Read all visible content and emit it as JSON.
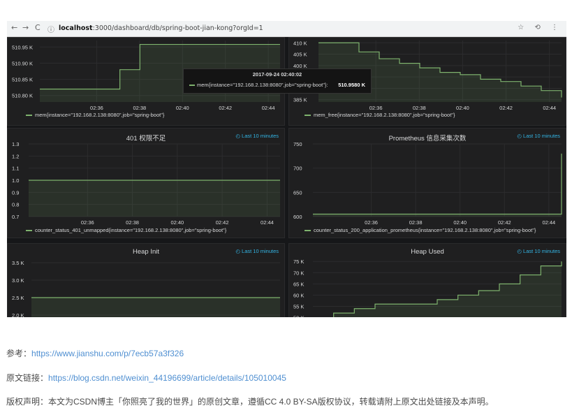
{
  "browser": {
    "url_host": "localhost",
    "url_rest": ":3000/dashboard/db/spring-boot-jian-kong?orgId=1",
    "back": "←",
    "forward": "→",
    "reload": "C",
    "info": "ⓘ"
  },
  "colors": {
    "series": "#7eb26d",
    "time_link": "#33b5e5",
    "panel_bg": "#1f1f20",
    "page_bg": "#161719"
  },
  "panels": [
    {
      "id": "mem",
      "title": "",
      "time_label": "",
      "legend": "mem{instance=\"192.168.2.138:8080\",job=\"spring-boot\"}"
    },
    {
      "id": "mem_free",
      "title": "",
      "time_label": "",
      "legend": "mem_free{instance=\"192.168.2.138:8080\",job=\"spring-boot\"}"
    },
    {
      "id": "c401",
      "title": "401 权限不足",
      "time_label": "◴ Last 10 minutes",
      "legend": "counter_status_401_unmapped{instance=\"192.168.2.138:8080\",job=\"spring-boot\"}"
    },
    {
      "id": "c200",
      "title": "Prometheus 信息采集次数",
      "time_label": "◴ Last 10 minutes",
      "legend": "counter_status_200_application_prometheus{instance=\"192.168.2.138:8080\",job=\"spring-boot\"}"
    },
    {
      "id": "heap_init",
      "title": "Heap Init",
      "time_label": "◴ Last 10 minutes",
      "legend": ""
    },
    {
      "id": "heap_used",
      "title": "Heap Used",
      "time_label": "◴ Last 10 minutes",
      "legend": ""
    }
  ],
  "tooltip": {
    "time": "2017-09-24 02:40:02",
    "label": "mem{instance=\"192.168.2.138:8080\",job=\"spring-boot\"}:",
    "value": "510.9580 K"
  },
  "chart_data": [
    {
      "id": "mem",
      "type": "line",
      "x_ticks": [
        "02:36",
        "02:38",
        "02:40",
        "02:42",
        "02:44"
      ],
      "y_ticks": [
        "510.95 K",
        "510.90 K",
        "510.85 K",
        "510.80 K"
      ],
      "ylim": [
        510.78,
        510.97
      ],
      "x": [
        0,
        1,
        2,
        3,
        4,
        5,
        6,
        7,
        8,
        9,
        10,
        11,
        12
      ],
      "y": [
        510.82,
        510.82,
        510.82,
        510.82,
        510.88,
        510.958,
        510.958,
        510.958,
        510.958,
        510.958,
        510.958,
        510.958,
        510.958
      ]
    },
    {
      "id": "mem_free",
      "type": "line",
      "x_ticks": [
        "02:36",
        "02:38",
        "02:40",
        "02:42",
        "02:44"
      ],
      "y_ticks": [
        "410 K",
        "405 K",
        "400 K",
        "395 K",
        "390 K",
        "385 K"
      ],
      "ylim": [
        384,
        411
      ],
      "x": [
        0,
        1,
        2,
        3,
        4,
        5,
        6,
        7,
        8,
        9,
        10,
        11,
        12
      ],
      "y": [
        410,
        410,
        406,
        403,
        401,
        399,
        397,
        396,
        394,
        393,
        391,
        389,
        386
      ]
    },
    {
      "id": "c401",
      "type": "line",
      "x_ticks": [
        "02:36",
        "02:38",
        "02:40",
        "02:42",
        "02:44"
      ],
      "y_ticks": [
        "1.3",
        "1.2",
        "1.1",
        "1.0",
        "0.9",
        "0.8",
        "0.7"
      ],
      "ylim": [
        0.7,
        1.3
      ],
      "x": [
        0,
        12
      ],
      "y": [
        1.0,
        1.0
      ]
    },
    {
      "id": "c200",
      "type": "line",
      "x_ticks": [
        "02:36",
        "02:38",
        "02:40",
        "02:42",
        "02:44"
      ],
      "y_ticks": [
        "750",
        "700",
        "650",
        "600"
      ],
      "ylim": [
        600,
        750
      ],
      "x": [
        0,
        12
      ],
      "y": [
        605,
        730
      ]
    },
    {
      "id": "heap_init",
      "type": "line",
      "x_ticks": [],
      "y_ticks": [
        "3.5 K",
        "3.0 K",
        "2.5 K",
        "2.0 K"
      ],
      "ylim": [
        1.8,
        3.6
      ],
      "x": [
        0,
        12
      ],
      "y": [
        2.5,
        2.5
      ]
    },
    {
      "id": "heap_used",
      "type": "line",
      "x_ticks": [],
      "y_ticks": [
        "75 K",
        "70 K",
        "65 K",
        "60 K",
        "55 K",
        "50 K"
      ],
      "ylim": [
        48,
        76
      ],
      "x": [
        0,
        1,
        2,
        3,
        4,
        5,
        6,
        7,
        8,
        9,
        10,
        11,
        12
      ],
      "y": [
        48,
        52,
        54,
        56,
        56,
        56,
        58,
        60,
        62,
        65,
        69,
        73,
        75
      ]
    }
  ],
  "meta": {
    "ref_label": "参考：",
    "ref_url": "https://www.jianshu.com/p/7ecb57a3f326",
    "orig_label": "原文链接：",
    "orig_url": "https://blog.csdn.net/weixin_44196699/article/details/105010045",
    "copyright": "版权声明：本文为CSDN博主「你照亮了我的世界」的原创文章，遵循CC 4.0 BY-SA版权协议，转载请附上原文出处链接及本声明。"
  }
}
